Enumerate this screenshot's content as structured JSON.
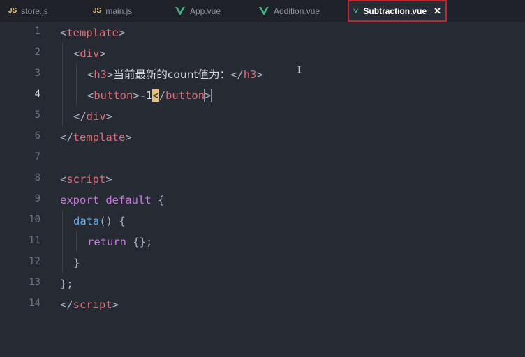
{
  "tabs": [
    {
      "icon": "JS",
      "label": "store.js"
    },
    {
      "icon": "JS",
      "label": "main.js"
    },
    {
      "icon": "vue",
      "label": "App.vue"
    },
    {
      "icon": "vue",
      "label": "Addition.vue"
    },
    {
      "icon": "vue",
      "label": "Subtraction.vue",
      "close": "✕"
    }
  ],
  "line_numbers": [
    "1",
    "2",
    "3",
    "4",
    "5",
    "6",
    "7",
    "8",
    "9",
    "10",
    "11",
    "12",
    "13",
    "14"
  ],
  "code": {
    "l1": {
      "open": "<",
      "tag": "template",
      "close": ">"
    },
    "l2": {
      "open": "<",
      "tag": "div",
      "close": ">"
    },
    "l3": {
      "open": "<",
      "tag": "h3",
      "close": ">",
      "text": "当前最新的count值为：",
      "open2": "</",
      "tag2": "h3",
      "close2": ">"
    },
    "l4": {
      "open": "<",
      "tag": "button",
      "close": ">",
      "text": "-1",
      "cursor": "<",
      "slash": "/",
      "tag2": "button",
      "close2": ">"
    },
    "l5": {
      "open": "</",
      "tag": "div",
      "close": ">"
    },
    "l6": {
      "open": "</",
      "tag": "template",
      "close": ">"
    },
    "l8": {
      "open": "<",
      "tag": "script",
      "close": ">"
    },
    "l9": {
      "kw1": "export",
      "kw2": "default",
      "brace": "{"
    },
    "l10": {
      "fn": "data",
      "parens": "()",
      "brace": "{"
    },
    "l11": {
      "kw": "return",
      "rest": "{};"
    },
    "l12": {
      "brace": "}"
    },
    "l13": {
      "brace": "};"
    },
    "l14": {
      "open": "</",
      "tag": "script",
      "close": ">"
    }
  },
  "mouse_cursor": "I",
  "colors": {
    "tag": "#e06c75",
    "keyword": "#c678dd",
    "function": "#61afef",
    "active_tab_border": "#c0262c",
    "vue_icon": "#42b883",
    "js_icon": "#e5c07b"
  }
}
